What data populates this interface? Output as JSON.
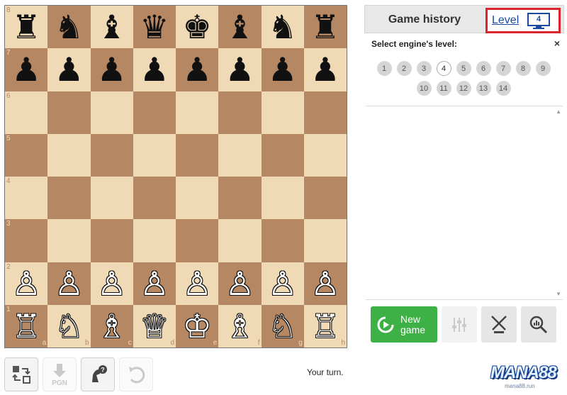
{
  "board": {
    "ranks": [
      "8",
      "7",
      "6",
      "5",
      "4",
      "3",
      "2",
      "1"
    ],
    "files": [
      "a",
      "b",
      "c",
      "d",
      "e",
      "f",
      "g",
      "h"
    ],
    "rows": [
      [
        "♜",
        "♞",
        "♝",
        "♛",
        "♚",
        "♝",
        "♞",
        "♜"
      ],
      [
        "♟",
        "♟",
        "♟",
        "♟",
        "♟",
        "♟",
        "♟",
        "♟"
      ],
      [
        "",
        "",
        "",
        "",
        "",
        "",
        "",
        ""
      ],
      [
        "",
        "",
        "",
        "",
        "",
        "",
        "",
        ""
      ],
      [
        "",
        "",
        "",
        "",
        "",
        "",
        "",
        ""
      ],
      [
        "",
        "",
        "",
        "",
        "",
        "",
        "",
        ""
      ],
      [
        "♙",
        "♙",
        "♙",
        "♙",
        "♙",
        "♙",
        "♙",
        "♙"
      ],
      [
        "♖",
        "♘",
        "♗",
        "♕",
        "♔",
        "♗",
        "♘",
        "♖"
      ]
    ],
    "colors": {
      "light": "#f0dab5",
      "dark": "#b58863"
    }
  },
  "toolbar": {
    "buttons": [
      {
        "icon": "flip-board-icon",
        "enabled": true
      },
      {
        "icon": "download-pgn-icon",
        "label": "PGN",
        "enabled": false
      },
      {
        "icon": "hint-icon",
        "label": "?",
        "enabled": true
      },
      {
        "icon": "undo-icon",
        "enabled": false
      }
    ],
    "status": "Your turn."
  },
  "panel": {
    "tab_history": "Game history",
    "level_link": "Level",
    "level_value": "4",
    "select_title": "Select engine's level:",
    "close": "×",
    "levels": [
      "1",
      "2",
      "3",
      "4",
      "5",
      "6",
      "7",
      "8",
      "9",
      "10",
      "11",
      "12",
      "13",
      "14"
    ],
    "active_level": "4",
    "new_game_label_1": "New",
    "new_game_label_2": "game",
    "accent": "#3db046",
    "highlight": "#d9252b"
  },
  "logo": {
    "text": "MANA88",
    "sub": "mana88.run"
  }
}
